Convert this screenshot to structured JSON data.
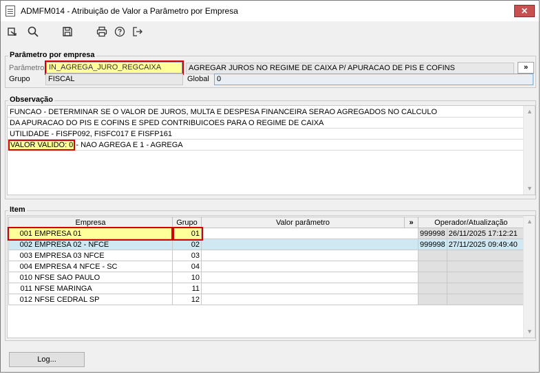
{
  "window": {
    "title": "ADMFM014 - Atribuição de Valor a Parâmetro por Empresa",
    "close_glyph": "✕"
  },
  "toolbar": {
    "icons": [
      "export-icon",
      "search-icon",
      "save-icon",
      "print-icon",
      "help-icon",
      "exit-icon"
    ]
  },
  "param_section": {
    "heading": "Parâmetro por empresa",
    "param_label": "Parâmetro",
    "param_value": "IN_AGREGA_JURO_REGCAIXA",
    "param_description": "AGREGAR JUROS NO REGIME DE CAIXA P/ APURACAO DE PIS E COFINS",
    "expand_label": "»",
    "group_label": "Grupo",
    "group_value": "FISCAL",
    "global_label": "Global",
    "global_value": "0"
  },
  "observation": {
    "heading": "Observação",
    "lines": [
      "FUNCAO - DETERMINAR SE O VALOR DE JUROS, MULTA E DESPESA FINANCEIRA SERAO AGREGADOS NO CALCULO",
      "DA APURACAO DO PIS E COFINS E SPED CONTRIBUICOES PARA O REGIME DE CAIXA",
      "UTILIDADE - FISFP092, FISFC017 E FISFP161"
    ],
    "last_line_highlight": "VALOR VALIDO: 0",
    "last_line_rest": " - NAO AGREGA E 1 - AGREGA"
  },
  "items": {
    "heading": "Item",
    "columns": {
      "empresa": "Empresa",
      "grupo": "Grupo",
      "valor": "Valor parâmetro",
      "expand": "»",
      "operador": "Operador/Atualização"
    },
    "rows": [
      {
        "code": "001",
        "name": "EMPRESA 01",
        "grupo": "01",
        "valor": "",
        "operador": "999998",
        "data": "26/11/2025 17:12:21"
      },
      {
        "code": "002",
        "name": "EMPRESA 02 - NFCE",
        "grupo": "02",
        "valor": "",
        "operador": "999998",
        "data": "27/11/2025 09:49:40"
      },
      {
        "code": "003",
        "name": "EMPRESA 03 NFCE",
        "grupo": "03",
        "valor": "",
        "operador": "",
        "data": ""
      },
      {
        "code": "004",
        "name": "EMPRESA 4 NFCE - SC",
        "grupo": "04",
        "valor": "",
        "operador": "",
        "data": ""
      },
      {
        "code": "010",
        "name": "NFSE SAO PAULO",
        "grupo": "10",
        "valor": "",
        "operador": "",
        "data": ""
      },
      {
        "code": "011",
        "name": "NFSE MARINGA",
        "grupo": "11",
        "valor": "",
        "operador": "",
        "data": ""
      },
      {
        "code": "012",
        "name": "NFSE CEDRAL SP",
        "grupo": "12",
        "valor": "",
        "operador": "",
        "data": ""
      }
    ]
  },
  "footer": {
    "log_button": "Log..."
  }
}
